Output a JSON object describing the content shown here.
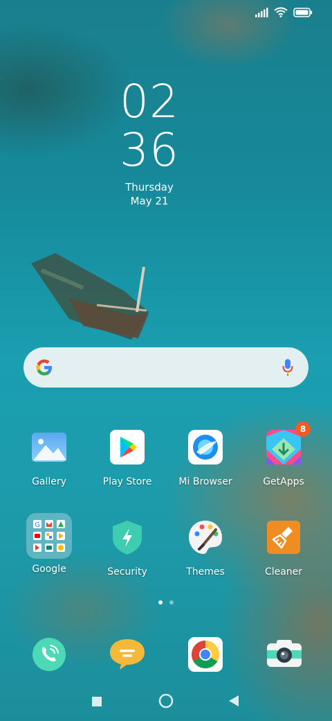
{
  "clock": {
    "hour": "02",
    "minute": "36",
    "day": "Thursday",
    "date": "May 21"
  },
  "apps": [
    {
      "label": "Gallery",
      "icon": "gallery-icon"
    },
    {
      "label": "Play Store",
      "icon": "play-store-icon"
    },
    {
      "label": "Mi Browser",
      "icon": "mi-browser-icon"
    },
    {
      "label": "GetApps",
      "icon": "getapps-icon",
      "badge": "8"
    },
    {
      "label": "Google",
      "icon": "google-folder-icon"
    },
    {
      "label": "Security",
      "icon": "security-icon"
    },
    {
      "label": "Themes",
      "icon": "themes-icon"
    },
    {
      "label": "Cleaner",
      "icon": "cleaner-icon"
    }
  ],
  "dock": [
    "phone-icon",
    "messages-icon",
    "chrome-icon",
    "camera-icon"
  ],
  "pages": {
    "current": 1,
    "total": 2
  },
  "status": {
    "signal": "signal-icon",
    "wifi": "wifi-icon",
    "battery": "battery-icon"
  },
  "navigation": [
    "recents-button",
    "home-button",
    "back-button"
  ],
  "colors": {
    "badge": "#f35b26",
    "security": "#3ecdb0",
    "messages": "#f5b93a",
    "cleaner": "#f08d22",
    "phone": "#4dd9b5"
  }
}
